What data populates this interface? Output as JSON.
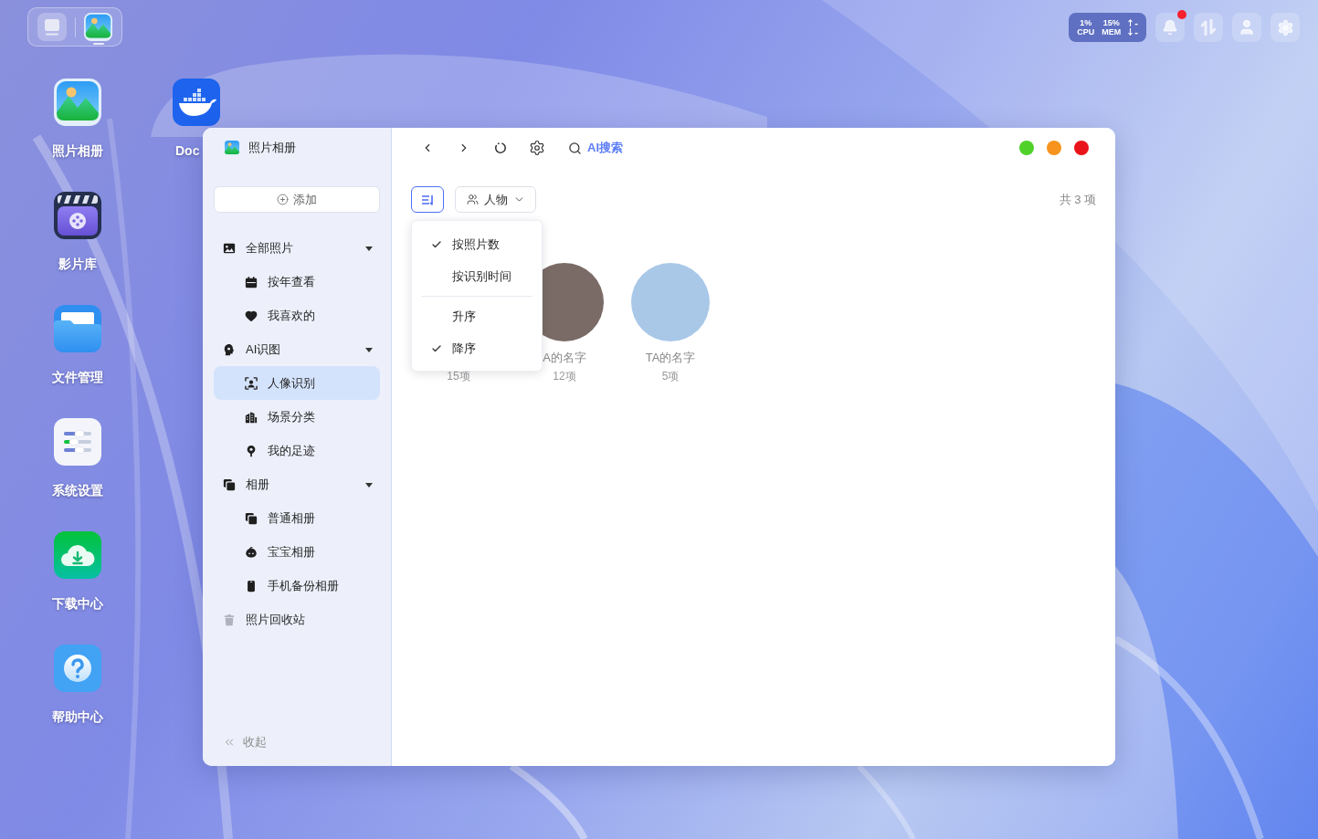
{
  "taskbar": {
    "items": [
      {
        "kind": "desktop",
        "selected": false
      },
      {
        "kind": "photos",
        "selected": true
      }
    ]
  },
  "status": {
    "cpu": {
      "value": "1%",
      "label": "CPU"
    },
    "memory": {
      "value": "15%",
      "label": "MEM"
    },
    "upload": "-",
    "download": "-",
    "notifications": {
      "unread": true
    }
  },
  "desktop": {
    "columns": [
      [
        {
          "kind": "photos",
          "label": "照片相册"
        },
        {
          "kind": "video",
          "label": "影片库"
        },
        {
          "kind": "files",
          "label": "文件管理"
        },
        {
          "kind": "settings",
          "label": "系统设置"
        },
        {
          "kind": "download",
          "label": "下载中心"
        },
        {
          "kind": "help",
          "label": "帮助中心"
        }
      ],
      [
        {
          "kind": "docker",
          "label": "Doc"
        }
      ]
    ]
  },
  "window": {
    "sidebar": {
      "title": "照片相册",
      "add_button": "添加",
      "nav": [
        {
          "label": "全部照片",
          "kind": "photos",
          "selected": false,
          "expanded": true,
          "children": [
            {
              "label": "按年查看",
              "kind": "calendar",
              "selected": false
            },
            {
              "label": "我喜欢的",
              "kind": "heart",
              "selected": false
            }
          ]
        },
        {
          "label": "AI识图",
          "kind": "ai",
          "selected": false,
          "expanded": true,
          "children": [
            {
              "label": "人像识别",
              "kind": "face",
              "selected": true
            },
            {
              "label": "场景分类",
              "kind": "scene",
              "selected": false
            },
            {
              "label": "我的足迹",
              "kind": "pin",
              "selected": false
            }
          ]
        },
        {
          "label": "相册",
          "kind": "albums",
          "selected": false,
          "expanded": true,
          "children": [
            {
              "label": "普通相册",
              "kind": "albums",
              "selected": false
            },
            {
              "label": "宝宝相册",
              "kind": "baby",
              "selected": false
            },
            {
              "label": "手机备份相册",
              "kind": "phone",
              "selected": false
            }
          ]
        },
        {
          "label": "照片回收站",
          "kind": "trash",
          "selected": false
        }
      ],
      "collapse": "收起"
    },
    "header": {
      "search": "AI搜索"
    },
    "toolbar": {
      "sort_button": {
        "open": true
      },
      "filter": "人物",
      "total": "共 3 项"
    },
    "sort_menu": {
      "sections": [
        {
          "items": [
            {
              "label": "按照片数",
              "checked": true
            },
            {
              "label": "按识别时间",
              "checked": false
            }
          ]
        },
        {
          "items": [
            {
              "label": "升序",
              "checked": false
            },
            {
              "label": "降序",
              "checked": true
            }
          ]
        }
      ]
    },
    "people": [
      {
        "count": "15项"
      },
      {
        "name": "A的名字",
        "count": "12项"
      },
      {
        "name": "TA的名字",
        "count": "5项"
      }
    ]
  }
}
